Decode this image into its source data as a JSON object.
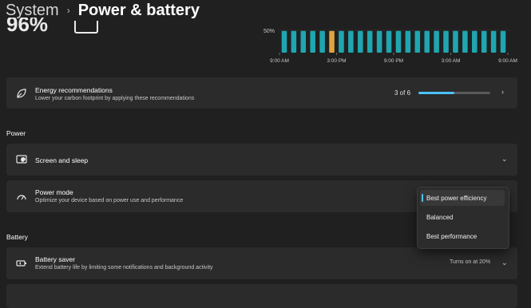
{
  "breadcrumb": {
    "parent": "System",
    "separator": "›",
    "current": "Power & battery"
  },
  "battery": {
    "percent_text": "96%"
  },
  "usage_chart": {
    "chart_data": {
      "type": "bar",
      "y_tick_label": "50%",
      "x_tick_labels": [
        "9:00 AM",
        "3:00 PM",
        "9:00 PM",
        "3:00 AM",
        "9:00 AM"
      ],
      "values": [
        0.8,
        0.8,
        0.8,
        0.8,
        0.8,
        0.8,
        0.8,
        0.8,
        0.8,
        0.8,
        0.8,
        0.8,
        0.8,
        0.8,
        0.8,
        0.8,
        0.8,
        0.8,
        0.8,
        0.8,
        0.8,
        0.8,
        0.8,
        0.8
      ],
      "highlight_index": 5,
      "colors": {
        "bar": "#1fa6b0",
        "highlight": "#e0a341"
      }
    }
  },
  "energy": {
    "title": "Energy recommendations",
    "subtitle": "Lower your carbon footprint by applying these recommendations",
    "count": "3 of 6",
    "progress_fraction": 0.5
  },
  "power_section": {
    "heading": "Power",
    "screen_sleep": {
      "title": "Screen and sleep"
    },
    "power_mode": {
      "title": "Power mode",
      "subtitle": "Optimize your device based on power use and performance",
      "options": [
        "Best power efficiency",
        "Balanced",
        "Best performance"
      ],
      "selected": "Best power efficiency"
    }
  },
  "battery_section": {
    "heading": "Battery",
    "saver": {
      "title": "Battery saver",
      "subtitle": "Extend battery life by limiting some notifications and background activity",
      "status": "Turns on at 20%"
    }
  },
  "colors": {
    "accent": "#4cc2ff",
    "card": "#2b2b2b",
    "background": "#202020"
  },
  "icons": [
    "leaf-icon",
    "screen-sleep-icon",
    "power-mode-icon",
    "battery-saver-icon",
    "chevron-right-icon",
    "chevron-down-icon"
  ]
}
